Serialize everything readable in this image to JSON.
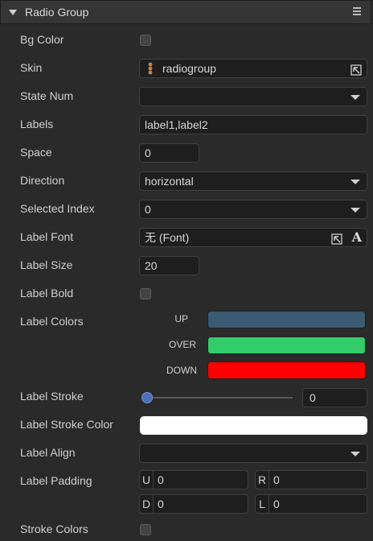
{
  "panel": {
    "title": "Radio Group",
    "menu_icon": "hamburger-icon"
  },
  "rows": {
    "bg_color": {
      "label": "Bg Color",
      "checked": false
    },
    "skin": {
      "label": "Skin",
      "value": "radiogroup",
      "icon": "resource-icon",
      "picker_icon": "pick-arrow-icon"
    },
    "state_num": {
      "label": "State Num",
      "value": ""
    },
    "labels": {
      "label": "Labels",
      "value": "label1,label2"
    },
    "space": {
      "label": "Space",
      "value": "0"
    },
    "direction": {
      "label": "Direction",
      "value": "horizontal"
    },
    "selected_index": {
      "label": "Selected Index",
      "value": "0"
    },
    "label_font": {
      "label": "Label Font",
      "value": "无 (Font)",
      "picker_icon": "pick-arrow-icon",
      "font_icon": "font-a-icon",
      "font_icon_glyph": "A"
    },
    "label_size": {
      "label": "Label Size",
      "value": "20"
    },
    "label_bold": {
      "label": "Label Bold",
      "checked": false
    },
    "label_colors": {
      "label": "Label Colors",
      "states": [
        {
          "name": "UP",
          "color": "#3a5b72"
        },
        {
          "name": "OVER",
          "color": "#33cc6b"
        },
        {
          "name": "DOWN",
          "color": "#ff0000"
        }
      ]
    },
    "label_stroke": {
      "label": "Label Stroke",
      "value": "0",
      "slider_fraction": 0
    },
    "label_stroke_color": {
      "label": "Label Stroke Color",
      "color": "#ffffff"
    },
    "label_align": {
      "label": "Label Align",
      "value": ""
    },
    "label_padding": {
      "label": "Label Padding",
      "u": {
        "key": "U",
        "value": "0"
      },
      "r": {
        "key": "R",
        "value": "0"
      },
      "d": {
        "key": "D",
        "value": "0"
      },
      "l": {
        "key": "L",
        "value": "0"
      }
    },
    "stroke_colors": {
      "label": "Stroke Colors",
      "checked": false
    }
  }
}
